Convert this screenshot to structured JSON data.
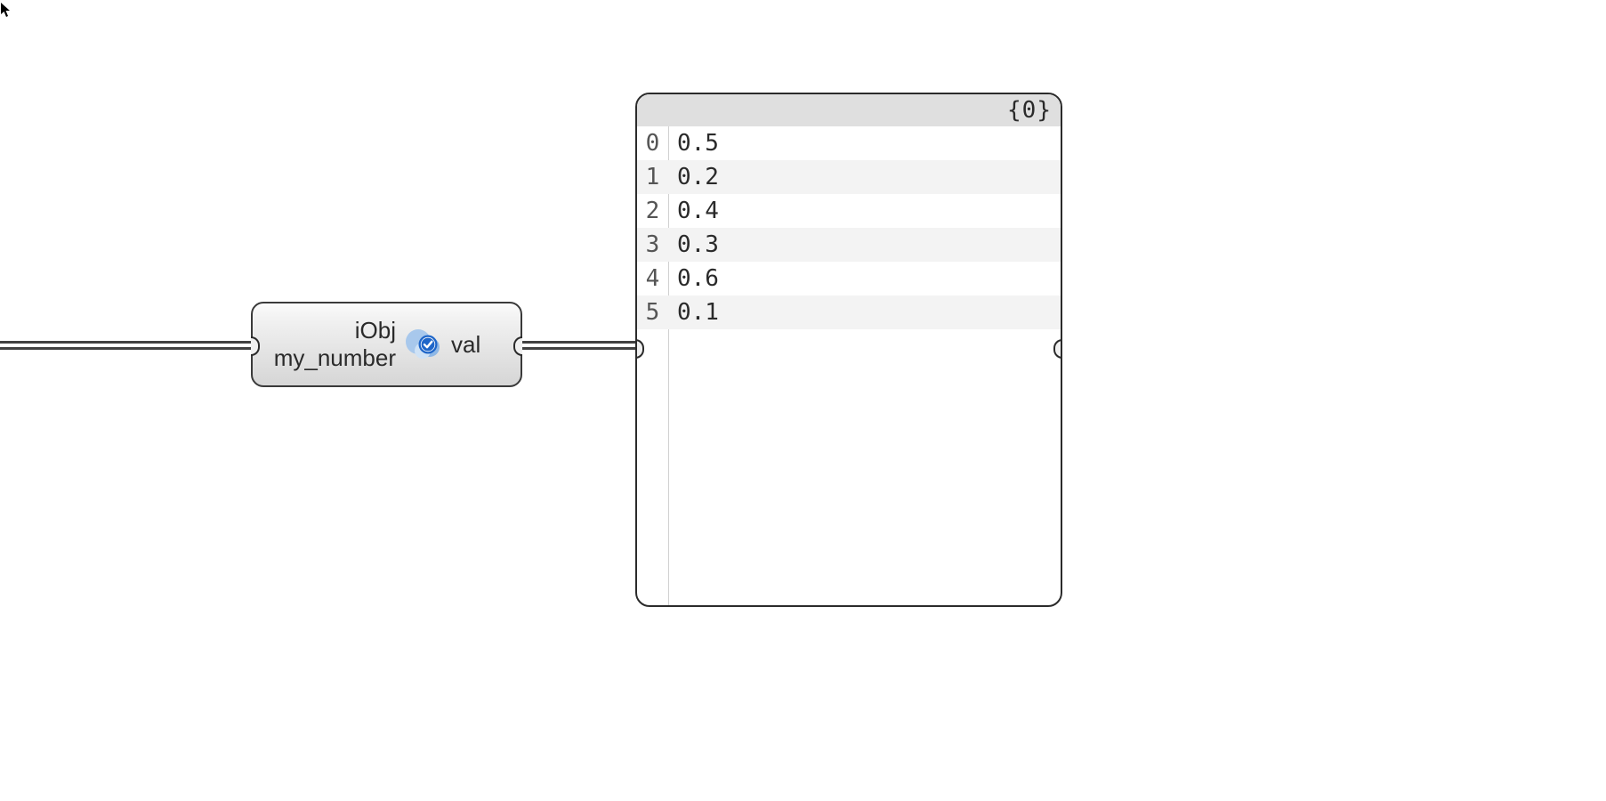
{
  "cursor": {
    "name": "mouse-pointer"
  },
  "component": {
    "input1_label": "iObj",
    "input2_label": "my_number",
    "output_label": "val",
    "icon": "lunchbox-check-icon"
  },
  "panel": {
    "header": "{0}",
    "rows": [
      {
        "index": "0",
        "value": "0.5"
      },
      {
        "index": "1",
        "value": "0.2"
      },
      {
        "index": "2",
        "value": "0.4"
      },
      {
        "index": "3",
        "value": "0.3"
      },
      {
        "index": "4",
        "value": "0.6"
      },
      {
        "index": "5",
        "value": "0.1"
      }
    ]
  }
}
